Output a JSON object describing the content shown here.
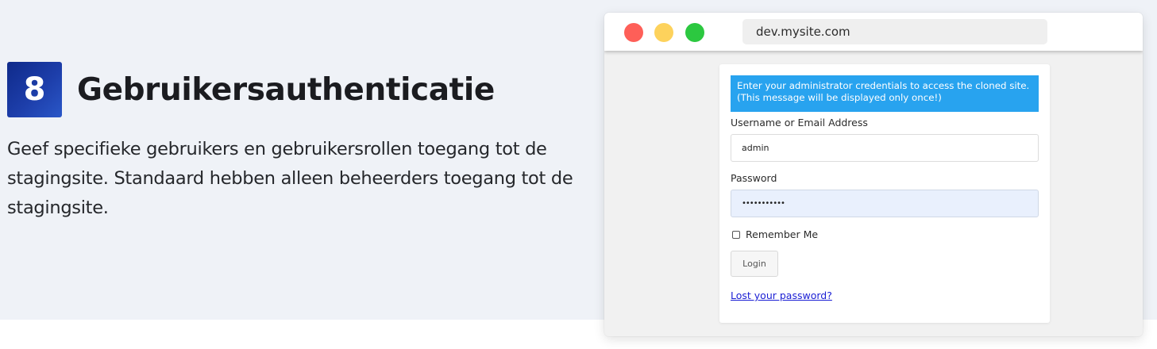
{
  "feature": {
    "number": "8",
    "title": "Gebruikersauthenticatie",
    "description": "Geef specifieke gebruikers en gebruikersrollen toegang tot de stagingsite. Standaard hebben alleen beheerders toegang tot de stagingsite."
  },
  "browser": {
    "url": "dev.mysite.com",
    "controls": {
      "close_color": "#fe5f58",
      "minimize_color": "#fdd25c",
      "maximize_color": "#2cc840"
    }
  },
  "login": {
    "notice_line1": "Enter your administrator credentials to access the cloned site.",
    "notice_line2": "(This message will be displayed only once!)",
    "username_label": "Username or Email Address",
    "username_value": "admin",
    "password_label": "Password",
    "password_value": "•••••••••••",
    "remember_label": "Remember Me",
    "login_button": "Login",
    "lost_password_link": "Lost your password?"
  },
  "colors": {
    "accent": "#1d3eaa",
    "notice_bg": "#28a3ef",
    "link": "#1a1ed4",
    "band_bg": "#eff2f7"
  }
}
